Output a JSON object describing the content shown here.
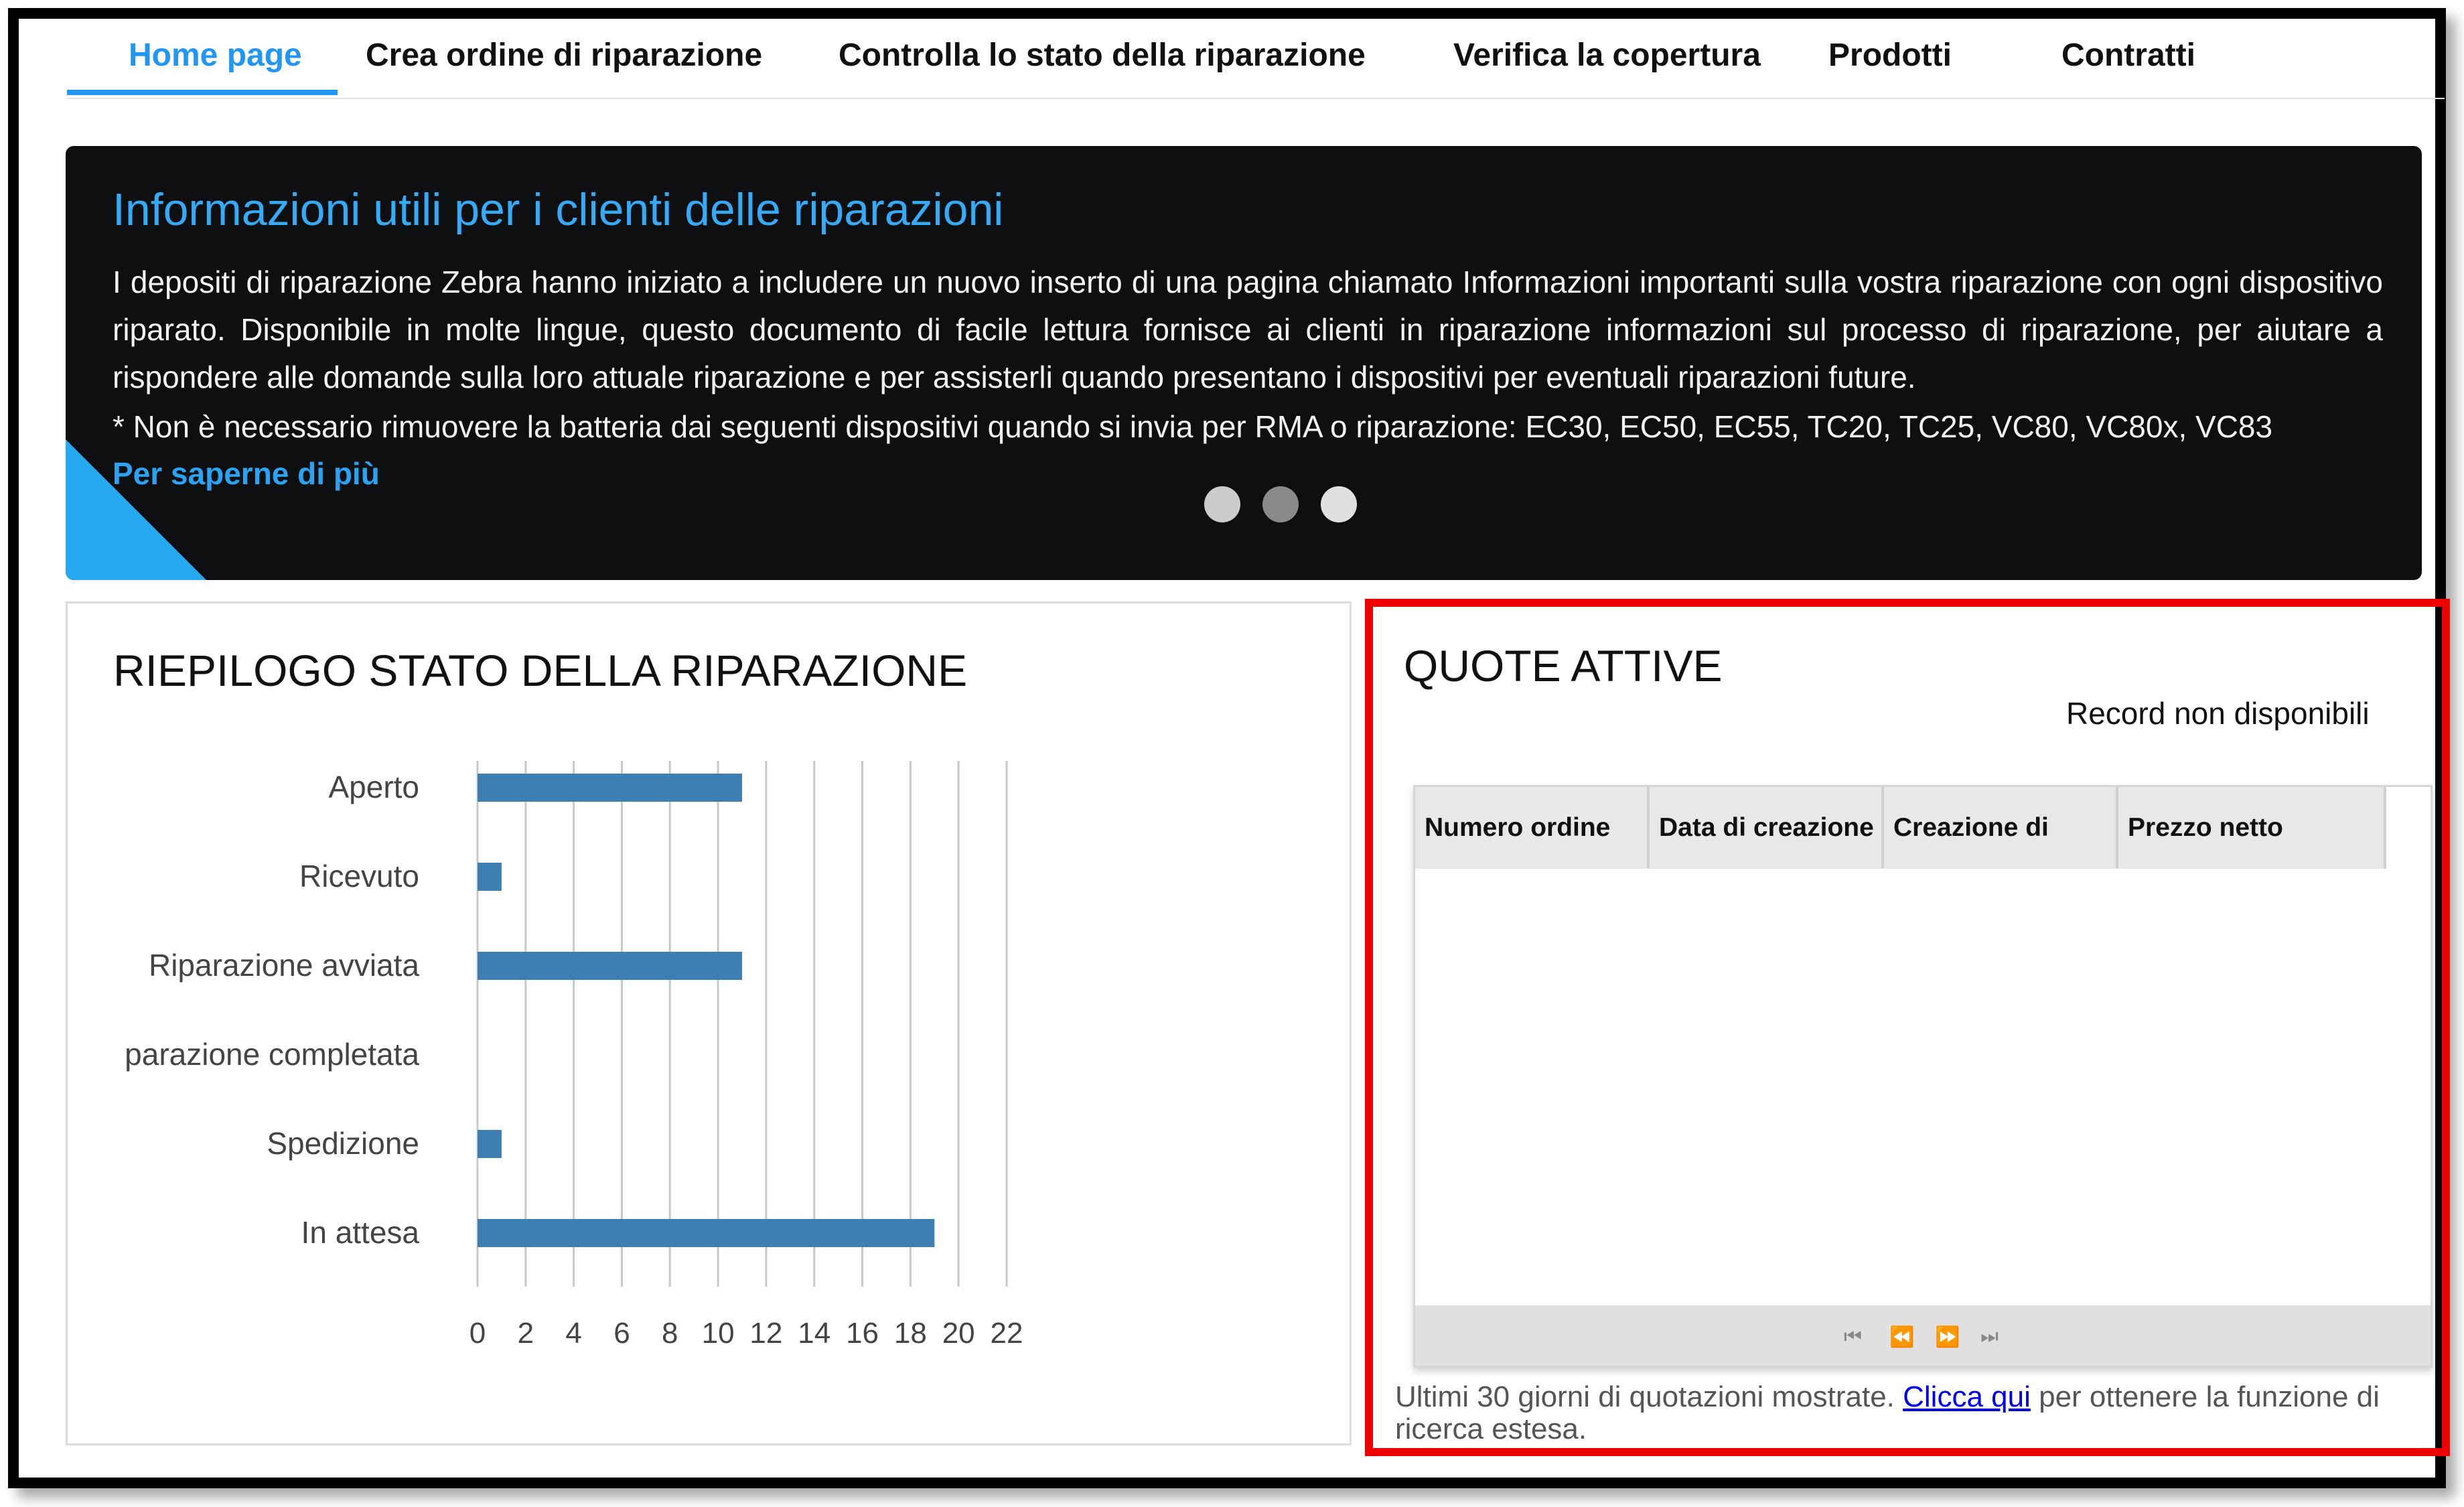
{
  "nav": {
    "tabs": [
      {
        "label": "Home page",
        "active": true
      },
      {
        "label": "Crea ordine di riparazione",
        "active": false
      },
      {
        "label": "Controlla lo stato della riparazione",
        "active": false
      },
      {
        "label": "Verifica la copertura",
        "active": false
      },
      {
        "label": "Prodotti",
        "active": false
      },
      {
        "label": "Contratti",
        "active": false
      }
    ]
  },
  "banner": {
    "title": "Informazioni utili per i clienti delle riparazioni",
    "body": "I depositi di riparazione Zebra hanno iniziato a includere un nuovo inserto di una pagina chiamato Informazioni importanti sulla vostra riparazione con ogni dispositivo riparato. Disponibile in molte lingue, questo documento di facile lettura fornisce ai clienti in riparazione informazioni sul processo di riparazione, per aiutare a rispondere alle domande sulla loro attuale riparazione e per assisterli quando presentano i dispositivi per eventuali riparazioni future.",
    "note": "* Non è necessario rimuovere la batteria dai seguenti dispositivi quando si invia per RMA o riparazione: EC30, EC50, EC55, TC20, TC25, VC80, VC80x, VC83",
    "link_label": "Per saperne di più",
    "dots": [
      {
        "color": "#cccccc"
      },
      {
        "color": "#8a8a8a"
      },
      {
        "color": "#e0e0e0"
      }
    ]
  },
  "summary": {
    "title": "RIEPILOGO STATO DELLA RIPARAZIONE"
  },
  "chart_data": {
    "type": "bar",
    "orientation": "horizontal",
    "categories": [
      "Aperto",
      "Ricevuto",
      "Riparazione avviata",
      "parazione completata",
      "Spedizione",
      "In attesa"
    ],
    "values": [
      11,
      1,
      11,
      0,
      1,
      19
    ],
    "xlim": [
      0,
      22
    ],
    "xticks": [
      0,
      2,
      4,
      6,
      8,
      10,
      12,
      14,
      16,
      18,
      20,
      22
    ],
    "grid": true,
    "bar_color": "#3d7fb3"
  },
  "quotes": {
    "title": "QUOTE ATTIVE",
    "empty_label": "Record non disponibili",
    "columns": [
      "Numero ordine",
      "Data di creazione",
      "Creazione di",
      "Prezzo netto"
    ],
    "pager_icons": [
      "first-page-icon",
      "prev-page-icon",
      "next-page-icon",
      "last-page-icon"
    ],
    "footnote_before": "Ultimi 30  giorni di quotazioni mostrate. ",
    "footnote_link": "Clicca qui",
    "footnote_after": " per ottenere la funzione di ricerca estesa."
  },
  "colors": {
    "accent": "#2196f3",
    "highlight_border": "#ee0000",
    "banner_bg": "#0d0f10"
  }
}
